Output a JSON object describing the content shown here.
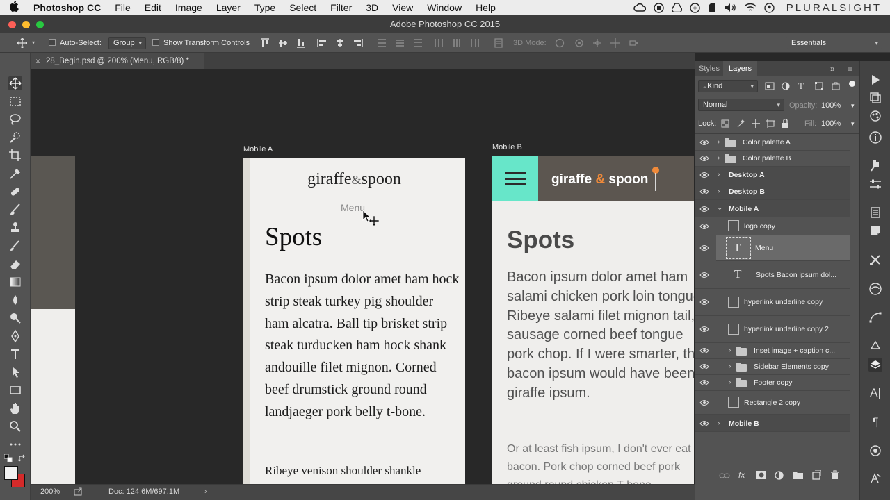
{
  "menubar": {
    "app_name": "Photoshop CC",
    "items": [
      "File",
      "Edit",
      "Image",
      "Layer",
      "Type",
      "Select",
      "Filter",
      "3D",
      "View",
      "Window",
      "Help"
    ],
    "brand": "PLURALSIGHT"
  },
  "window": {
    "title": "Adobe Photoshop CC 2015"
  },
  "options_bar": {
    "auto_select_label": "Auto-Select:",
    "auto_select_value": "Group",
    "show_transform_label": "Show Transform Controls",
    "mode_3d_label": "3D Mode:",
    "workspace": "Essentials"
  },
  "document": {
    "tab_title": "28_Begin.psd @ 200% (Menu, RGB/8) *"
  },
  "artboard_a": {
    "label": "Mobile A",
    "logo_left": "giraffe",
    "logo_amp": "&",
    "logo_right": "spoon",
    "menu": "Menu",
    "heading": "Spots",
    "body": "Bacon ipsum dolor amet ham hock strip steak turkey pig shoulder ham alcatra. Ball tip brisket strip steak turducken ham hock shank andouille filet mignon. Corned beef drumstick ground round landjaeger pork belly t-bone.",
    "body2": "Ribeye venison shoulder shankle"
  },
  "artboard_b": {
    "label": "Mobile B",
    "logo_left": "giraffe",
    "logo_amp": "&",
    "logo_right": "spoon",
    "heading": "Spots",
    "body": "Bacon ipsum dolor amet ham salami chicken pork loin tongue. Ribeye salami filet mignon tail, sausage corned beef tongue pork chop. If I were smarter, this bacon ipsum would have been giraffe ipsum.",
    "body2": "Or at least fish ipsum, I don't ever eat bacon. Pork chop corned beef pork ground round chicken T-bone"
  },
  "status_bar": {
    "zoom": "200%",
    "doc": "Doc: 124.6M/697.1M"
  },
  "panel": {
    "tabs": [
      "Styles",
      "Layers"
    ],
    "filter_kind": "Kind",
    "blend_mode": "Normal",
    "opacity_label": "Opacity:",
    "opacity_value": "100%",
    "lock_label": "Lock:",
    "fill_label": "Fill:",
    "fill_value": "100%",
    "layers": [
      {
        "name": "Color palette A",
        "kind": "group"
      },
      {
        "name": "Color palette B",
        "kind": "group"
      },
      {
        "name": "Desktop A",
        "kind": "artboard"
      },
      {
        "name": "Desktop B",
        "kind": "artboard"
      },
      {
        "name": "Mobile A",
        "kind": "artboard"
      },
      {
        "name": "logo copy",
        "kind": "smart"
      },
      {
        "name": "Menu",
        "kind": "text"
      },
      {
        "name": "Spots Bacon ipsum dol...",
        "kind": "text"
      },
      {
        "name": "hyperlink underline copy",
        "kind": "smart"
      },
      {
        "name": "hyperlink underline copy 2",
        "kind": "smart"
      },
      {
        "name": "Inset image + caption c...",
        "kind": "group"
      },
      {
        "name": "Sidebar Elements copy",
        "kind": "group"
      },
      {
        "name": "Footer copy",
        "kind": "group"
      },
      {
        "name": "Rectangle 2 copy",
        "kind": "smart"
      },
      {
        "name": "Mobile B",
        "kind": "artboard"
      }
    ]
  },
  "colors": {
    "accent_mint": "#67e6c9",
    "header_brown": "#5c5650",
    "logo_orange": "#f08a3a",
    "foreground_swatch": "#f2f2f2",
    "background_swatch": "#d42a2a"
  }
}
